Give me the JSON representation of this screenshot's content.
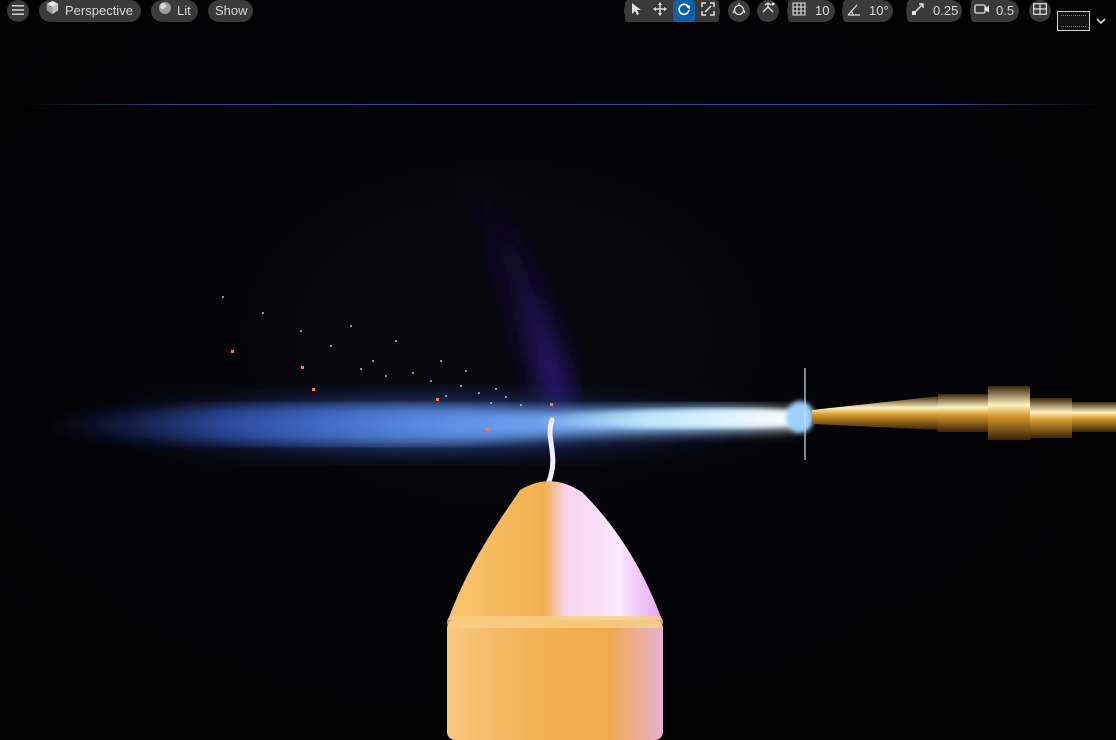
{
  "toolbar": {
    "menu_icon": "hamburger-icon",
    "view_mode_label": "Perspective",
    "view_mode_icon": "cube-icon",
    "lighting_label": "Lit",
    "lighting_icon": "sphere-icon",
    "show_label": "Show",
    "transform_tools": [
      {
        "name": "select",
        "icon": "cursor-icon",
        "active": false
      },
      {
        "name": "translate",
        "icon": "move-icon",
        "active": false
      },
      {
        "name": "rotate",
        "icon": "rotate-icon",
        "active": true
      },
      {
        "name": "scale",
        "icon": "scale-icon",
        "active": false
      }
    ],
    "coordinate_space_icon": "globe-icon",
    "surface_snap_icon": "surface-snap-icon",
    "grid_snap_value": "10",
    "rotation_snap_value": "10°",
    "scale_snap_value": "0.25",
    "camera_speed_value": "0.5",
    "maximize_icon": "viewport-grid-icon",
    "layout_icon": "layout-icon",
    "dropdown_icon": "chevron-down-icon"
  },
  "colors": {
    "toolbar_pill": "#3a3a3a",
    "active_tool": "#0f5ea8",
    "flame": "#4f8bff",
    "candle": "#f4b35c",
    "nozzle": "#d8a23a"
  }
}
